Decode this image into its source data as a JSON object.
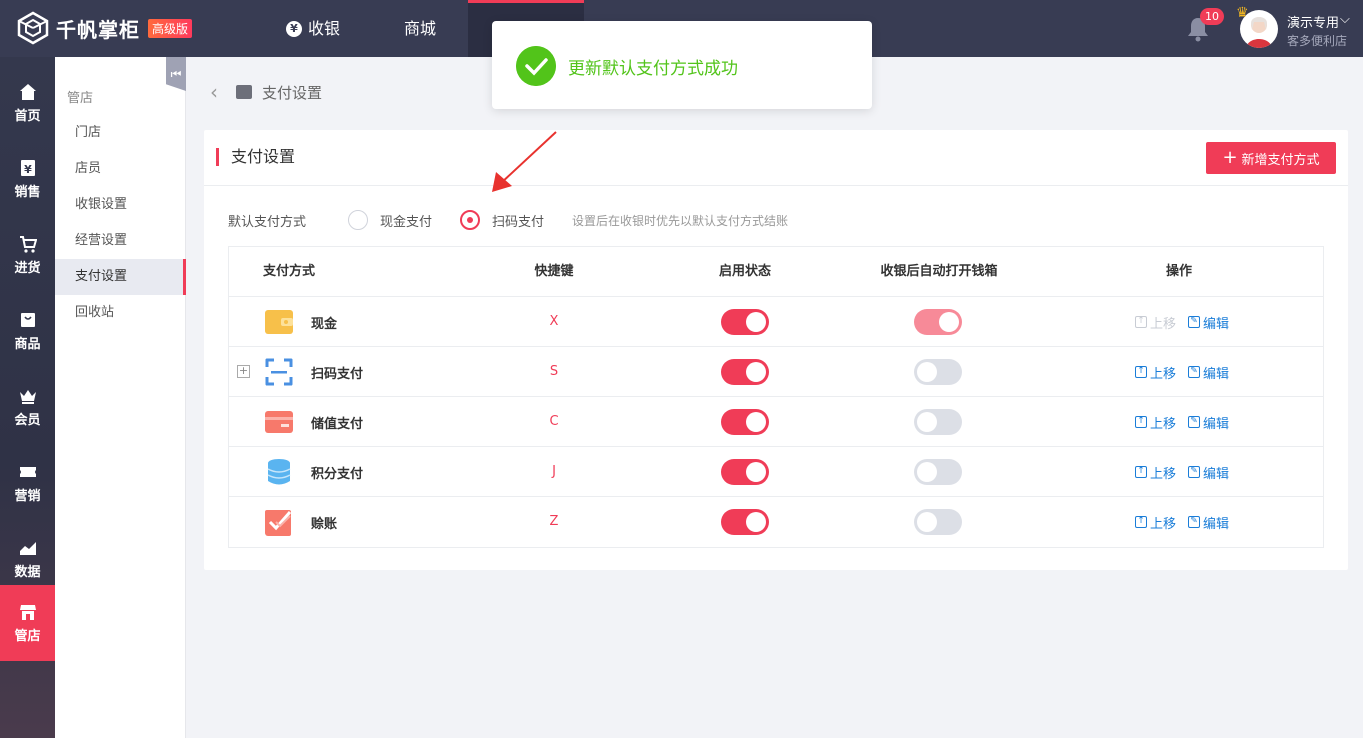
{
  "topbar": {
    "brand": "千帆掌柜",
    "edition_badge": "高级版",
    "nav": [
      {
        "label": "收银",
        "icon": "yen-icon"
      },
      {
        "label": "商城"
      }
    ],
    "notification_count": "10",
    "user_name": "演示专用",
    "store_name": "客多便利店"
  },
  "sidebar": {
    "items": [
      {
        "label": "首页",
        "icon": "home-icon"
      },
      {
        "label": "销售",
        "icon": "sales-icon"
      },
      {
        "label": "进货",
        "icon": "cart-icon"
      },
      {
        "label": "商品",
        "icon": "goods-icon"
      },
      {
        "label": "会员",
        "icon": "crown-icon"
      },
      {
        "label": "营销",
        "icon": "ticket-icon"
      },
      {
        "label": "数据",
        "icon": "chart-icon"
      },
      {
        "label": "管店",
        "icon": "store-icon",
        "active": true
      }
    ]
  },
  "subnav": {
    "title": "管店",
    "items": [
      "门店",
      "店员",
      "收银设置",
      "经营设置",
      "支付设置",
      "回收站"
    ],
    "active_index": 4
  },
  "breadcrumb": {
    "current": "支付设置"
  },
  "card": {
    "title": "支付设置",
    "add_button": "新增支付方式",
    "default_label": "默认支付方式",
    "default_options": [
      "现金支付",
      "扫码支付"
    ],
    "default_selected": 1,
    "hint": "设置后在收银时优先以默认支付方式结账"
  },
  "table": {
    "headers": [
      "支付方式",
      "快捷键",
      "启用状态",
      "收银后自动打开钱箱",
      "操作"
    ],
    "rows": [
      {
        "name": "现金",
        "key": "X",
        "enabled": true,
        "drawer": true,
        "drawer_disabled": true,
        "move_up": "上移",
        "move_up_disabled": true,
        "edit": "编辑",
        "icon": "wallet-icon",
        "color": "#f7c04a"
      },
      {
        "name": "扫码支付",
        "key": "S",
        "enabled": true,
        "drawer": false,
        "move_up": "上移",
        "edit": "编辑",
        "icon": "scan-icon",
        "color": "#4a90e2",
        "expandable": true
      },
      {
        "name": "储值支付",
        "key": "C",
        "enabled": true,
        "drawer": false,
        "move_up": "上移",
        "edit": "编辑",
        "icon": "card-icon",
        "color": "#f7796b"
      },
      {
        "name": "积分支付",
        "key": "J",
        "enabled": true,
        "drawer": false,
        "move_up": "上移",
        "edit": "编辑",
        "icon": "coins-icon",
        "color": "#5ab4f0"
      },
      {
        "name": "赊账",
        "key": "Z",
        "enabled": true,
        "drawer": false,
        "move_up": "上移",
        "edit": "编辑",
        "icon": "credit-icon",
        "color": "#f7796b"
      }
    ]
  },
  "toast": {
    "message": "更新默认支付方式成功"
  },
  "colors": {
    "accent": "#f03c57",
    "link": "#1a7dd8",
    "success": "#52c41a",
    "topbar": "#383c53"
  }
}
